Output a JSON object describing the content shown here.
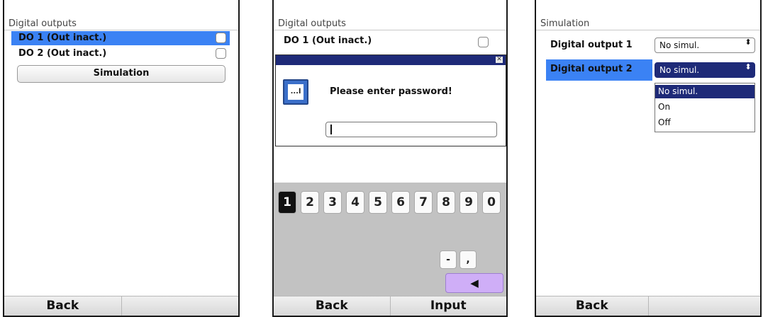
{
  "screen1": {
    "title": "Digital outputs",
    "rows": [
      {
        "label": "DO 1 (Out inact.)",
        "selected": true
      },
      {
        "label": "DO 2 (Out inact.)",
        "selected": false
      }
    ],
    "simulation_button": "Simulation",
    "footer": {
      "left": "Back",
      "right": ""
    }
  },
  "screen2": {
    "title": "Digital outputs",
    "row": "DO 1 (Out inact.)",
    "dialog": {
      "close_glyph": "✕",
      "icon_text": "...l",
      "message": "Please enter password!",
      "input_value": ""
    },
    "keys": [
      "1",
      "2",
      "3",
      "4",
      "5",
      "6",
      "7",
      "8",
      "9",
      "0"
    ],
    "active_key": "1",
    "special_keys": [
      "-",
      ","
    ],
    "enter_glyph": "◀",
    "footer": {
      "left": "Back",
      "right": "Input"
    }
  },
  "screen3": {
    "title": "Simulation",
    "outputs": [
      {
        "label": "Digital output 1",
        "value": "No simul."
      },
      {
        "label": "Digital output 2",
        "value": "No simul."
      }
    ],
    "spin_glyph": "⬍",
    "options": [
      "No simul.",
      "On",
      "Off"
    ],
    "highlighted_option": "No simul.",
    "footer": {
      "left": "Back",
      "right": ""
    }
  },
  "colors": {
    "selection_blue": "#3b82f4",
    "dialog_bar": "#1e2a78",
    "enter_key": "#cfaef7",
    "keypad_bg": "#c2c2c2"
  }
}
